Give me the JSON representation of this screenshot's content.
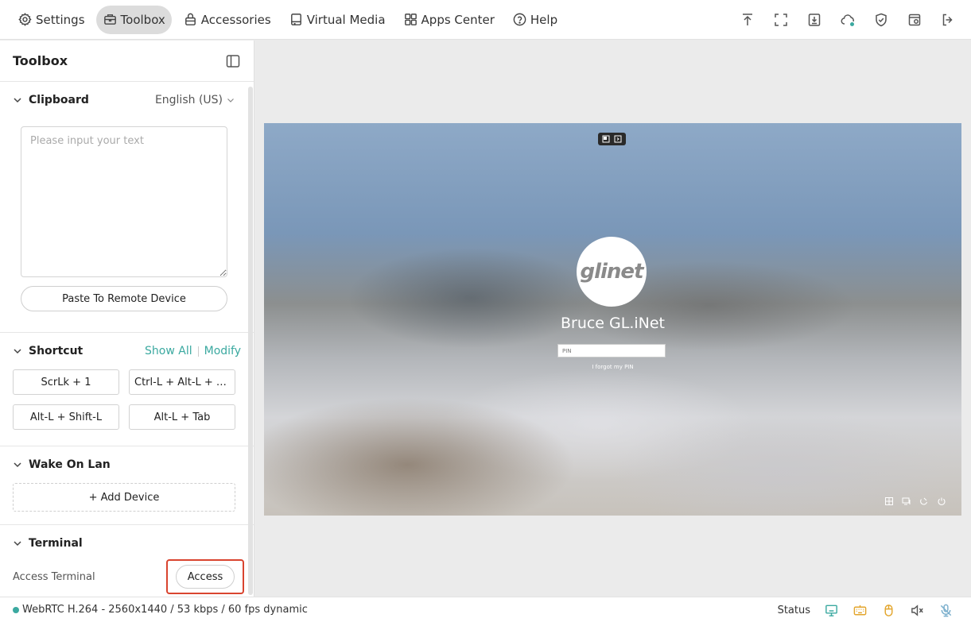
{
  "nav": {
    "items": [
      {
        "label": "Settings",
        "icon": "gear-icon",
        "active": false
      },
      {
        "label": "Toolbox",
        "icon": "toolbox-icon",
        "active": true
      },
      {
        "label": "Accessories",
        "icon": "bag-icon",
        "active": false
      },
      {
        "label": "Virtual Media",
        "icon": "disk-icon",
        "active": false
      },
      {
        "label": "Apps Center",
        "icon": "grid-icon",
        "active": false
      },
      {
        "label": "Help",
        "icon": "help-icon",
        "active": false
      }
    ],
    "right_icons": [
      "upload-icon",
      "fullscreen-icon",
      "download-icon",
      "cloud-icon",
      "shield-icon",
      "window-icon",
      "logout-icon"
    ],
    "accent": "#3ba9a0"
  },
  "sidebar": {
    "title": "Toolbox",
    "clipboard": {
      "title": "Clipboard",
      "language": "English (US)",
      "placeholder": "Please input your text",
      "paste_label": "Paste To Remote Device"
    },
    "shortcut": {
      "title": "Shortcut",
      "show_all": "Show All",
      "modify": "Modify",
      "buttons": [
        "ScrLk + 1",
        "Ctrl-L + Alt-L + D...",
        "Alt-L + Shift-L",
        "Alt-L + Tab"
      ]
    },
    "wake_on_lan": {
      "title": "Wake On Lan",
      "add_label": "+ Add Device"
    },
    "terminal": {
      "title": "Terminal",
      "label": "Access Terminal",
      "button": "Access",
      "highlight_color": "#d9442f"
    }
  },
  "remote": {
    "logo_text": "glinet",
    "user_name": "Bruce GL.iNet",
    "pin_placeholder": "PIN",
    "forgot": "I forgot my PIN"
  },
  "status": {
    "stream": "WebRTC H.264 - 2560x1440 / 53 kbps / 60 fps dynamic",
    "label": "Status",
    "icons": [
      "monitor-icon",
      "keyboard-icon",
      "mouse-icon",
      "mute-icon",
      "mic-off-icon"
    ]
  }
}
